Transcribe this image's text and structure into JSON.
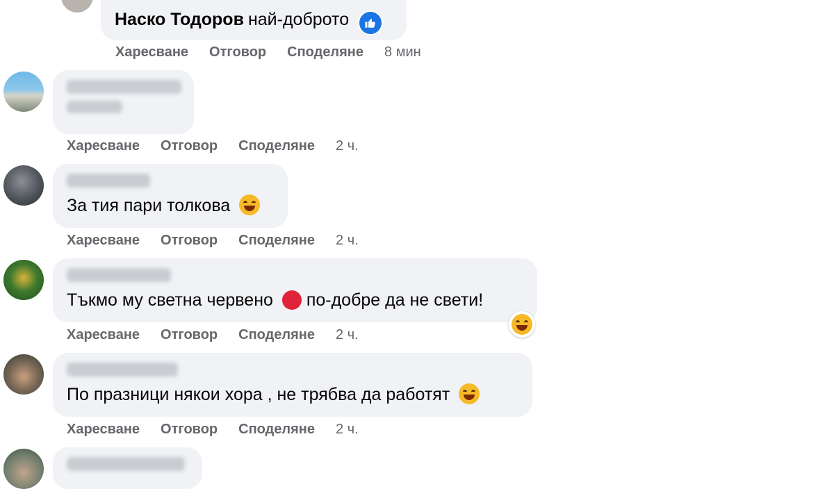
{
  "colors": {
    "bubble_bg": "#f0f2f5",
    "action_text": "#65676b",
    "like_blue": "#1b74e4",
    "red_circle": "#e0223a"
  },
  "comments": [
    {
      "author": "Наско Тодоров",
      "text": "най-доброто",
      "reaction": "like-icon",
      "actions": {
        "like": "Харесване",
        "reply": "Отговор",
        "share": "Споделяне",
        "time": "8 мин"
      }
    },
    {
      "author_blurred": true,
      "text_blurred": true,
      "actions": {
        "like": "Харесване",
        "reply": "Отговор",
        "share": "Споделяне",
        "time": "2 ч."
      }
    },
    {
      "author_blurred": true,
      "text": "За тия пари толкова",
      "emoji": "rolling-laugh-emoji",
      "actions": {
        "like": "Харесване",
        "reply": "Отговор",
        "share": "Споделяне",
        "time": "2 ч."
      }
    },
    {
      "author_blurred": true,
      "text": "Тъкмо му светна червено",
      "text_after": "по-добре да не свети!",
      "emoji": "red-circle-emoji",
      "reaction": "laugh-reaction-icon",
      "actions": {
        "like": "Харесване",
        "reply": "Отговор",
        "share": "Споделяне",
        "time": "2 ч."
      }
    },
    {
      "author_blurred": true,
      "text": "По празници някои хора , не трябва да работят",
      "emoji": "laughing-tears-emoji",
      "actions": {
        "like": "Харесване",
        "reply": "Отговор",
        "share": "Споделяне",
        "time": "2 ч."
      }
    },
    {
      "author_blurred": true,
      "text_blurred": true
    }
  ]
}
